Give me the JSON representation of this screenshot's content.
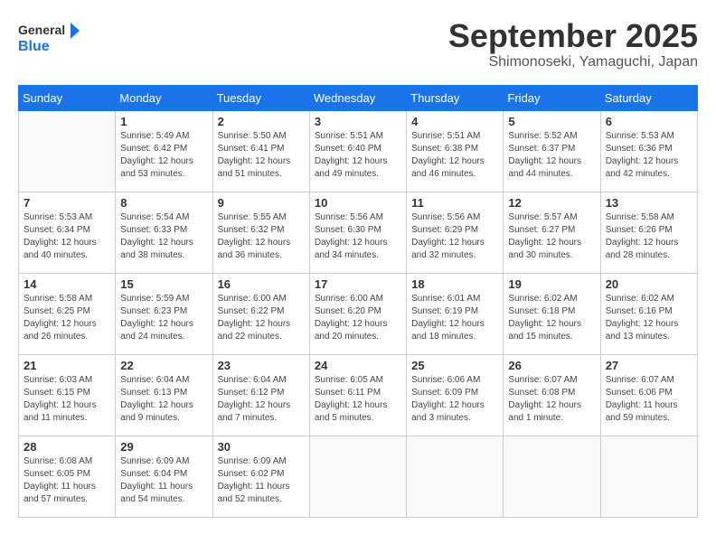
{
  "logo": {
    "line1": "General",
    "line2": "Blue"
  },
  "title": "September 2025",
  "location": "Shimonoseki, Yamaguchi, Japan",
  "days_of_week": [
    "Sunday",
    "Monday",
    "Tuesday",
    "Wednesday",
    "Thursday",
    "Friday",
    "Saturday"
  ],
  "weeks": [
    [
      {
        "day": "",
        "info": ""
      },
      {
        "day": "1",
        "info": "Sunrise: 5:49 AM\nSunset: 6:42 PM\nDaylight: 12 hours\nand 53 minutes."
      },
      {
        "day": "2",
        "info": "Sunrise: 5:50 AM\nSunset: 6:41 PM\nDaylight: 12 hours\nand 51 minutes."
      },
      {
        "day": "3",
        "info": "Sunrise: 5:51 AM\nSunset: 6:40 PM\nDaylight: 12 hours\nand 49 minutes."
      },
      {
        "day": "4",
        "info": "Sunrise: 5:51 AM\nSunset: 6:38 PM\nDaylight: 12 hours\nand 46 minutes."
      },
      {
        "day": "5",
        "info": "Sunrise: 5:52 AM\nSunset: 6:37 PM\nDaylight: 12 hours\nand 44 minutes."
      },
      {
        "day": "6",
        "info": "Sunrise: 5:53 AM\nSunset: 6:36 PM\nDaylight: 12 hours\nand 42 minutes."
      }
    ],
    [
      {
        "day": "7",
        "info": "Sunrise: 5:53 AM\nSunset: 6:34 PM\nDaylight: 12 hours\nand 40 minutes."
      },
      {
        "day": "8",
        "info": "Sunrise: 5:54 AM\nSunset: 6:33 PM\nDaylight: 12 hours\nand 38 minutes."
      },
      {
        "day": "9",
        "info": "Sunrise: 5:55 AM\nSunset: 6:32 PM\nDaylight: 12 hours\nand 36 minutes."
      },
      {
        "day": "10",
        "info": "Sunrise: 5:56 AM\nSunset: 6:30 PM\nDaylight: 12 hours\nand 34 minutes."
      },
      {
        "day": "11",
        "info": "Sunrise: 5:56 AM\nSunset: 6:29 PM\nDaylight: 12 hours\nand 32 minutes."
      },
      {
        "day": "12",
        "info": "Sunrise: 5:57 AM\nSunset: 6:27 PM\nDaylight: 12 hours\nand 30 minutes."
      },
      {
        "day": "13",
        "info": "Sunrise: 5:58 AM\nSunset: 6:26 PM\nDaylight: 12 hours\nand 28 minutes."
      }
    ],
    [
      {
        "day": "14",
        "info": "Sunrise: 5:58 AM\nSunset: 6:25 PM\nDaylight: 12 hours\nand 26 minutes."
      },
      {
        "day": "15",
        "info": "Sunrise: 5:59 AM\nSunset: 6:23 PM\nDaylight: 12 hours\nand 24 minutes."
      },
      {
        "day": "16",
        "info": "Sunrise: 6:00 AM\nSunset: 6:22 PM\nDaylight: 12 hours\nand 22 minutes."
      },
      {
        "day": "17",
        "info": "Sunrise: 6:00 AM\nSunset: 6:20 PM\nDaylight: 12 hours\nand 20 minutes."
      },
      {
        "day": "18",
        "info": "Sunrise: 6:01 AM\nSunset: 6:19 PM\nDaylight: 12 hours\nand 18 minutes."
      },
      {
        "day": "19",
        "info": "Sunrise: 6:02 AM\nSunset: 6:18 PM\nDaylight: 12 hours\nand 15 minutes."
      },
      {
        "day": "20",
        "info": "Sunrise: 6:02 AM\nSunset: 6:16 PM\nDaylight: 12 hours\nand 13 minutes."
      }
    ],
    [
      {
        "day": "21",
        "info": "Sunrise: 6:03 AM\nSunset: 6:15 PM\nDaylight: 12 hours\nand 11 minutes."
      },
      {
        "day": "22",
        "info": "Sunrise: 6:04 AM\nSunset: 6:13 PM\nDaylight: 12 hours\nand 9 minutes."
      },
      {
        "day": "23",
        "info": "Sunrise: 6:04 AM\nSunset: 6:12 PM\nDaylight: 12 hours\nand 7 minutes."
      },
      {
        "day": "24",
        "info": "Sunrise: 6:05 AM\nSunset: 6:11 PM\nDaylight: 12 hours\nand 5 minutes."
      },
      {
        "day": "25",
        "info": "Sunrise: 6:06 AM\nSunset: 6:09 PM\nDaylight: 12 hours\nand 3 minutes."
      },
      {
        "day": "26",
        "info": "Sunrise: 6:07 AM\nSunset: 6:08 PM\nDaylight: 12 hours\nand 1 minute."
      },
      {
        "day": "27",
        "info": "Sunrise: 6:07 AM\nSunset: 6:06 PM\nDaylight: 11 hours\nand 59 minutes."
      }
    ],
    [
      {
        "day": "28",
        "info": "Sunrise: 6:08 AM\nSunset: 6:05 PM\nDaylight: 11 hours\nand 57 minutes."
      },
      {
        "day": "29",
        "info": "Sunrise: 6:09 AM\nSunset: 6:04 PM\nDaylight: 11 hours\nand 54 minutes."
      },
      {
        "day": "30",
        "info": "Sunrise: 6:09 AM\nSunset: 6:02 PM\nDaylight: 11 hours\nand 52 minutes."
      },
      {
        "day": "",
        "info": ""
      },
      {
        "day": "",
        "info": ""
      },
      {
        "day": "",
        "info": ""
      },
      {
        "day": "",
        "info": ""
      }
    ]
  ]
}
